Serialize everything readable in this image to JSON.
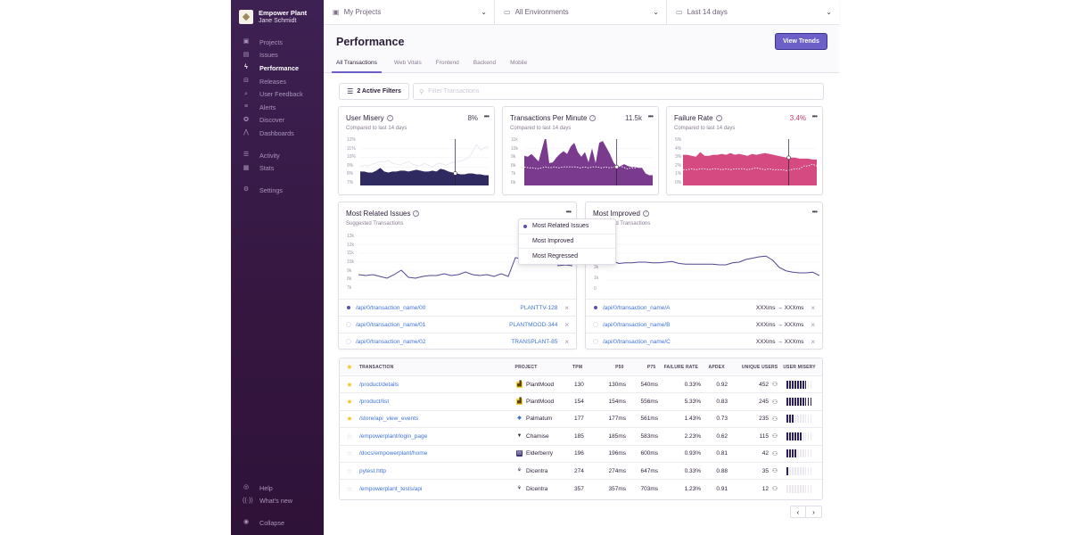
{
  "sidebar": {
    "org_name": "Empower Plant",
    "user_name": "Jane Schmidt",
    "items": [
      {
        "label": "Projects",
        "icon": "projects-icon",
        "glyph": "▣"
      },
      {
        "label": "Issues",
        "icon": "issues-icon",
        "glyph": "▤"
      },
      {
        "label": "Performance",
        "icon": "performance-icon",
        "glyph": "ϟ",
        "active": true
      },
      {
        "label": "Releases",
        "icon": "releases-icon",
        "glyph": "⊟"
      },
      {
        "label": "User Feedback",
        "icon": "user-feedback-icon",
        "glyph": "⌕"
      },
      {
        "label": "Alerts",
        "icon": "alerts-icon",
        "glyph": "≡"
      },
      {
        "label": "Discover",
        "icon": "discover-icon",
        "glyph": "✪"
      },
      {
        "label": "Dashboards",
        "icon": "dashboards-icon",
        "glyph": "⋀"
      }
    ],
    "items2": [
      {
        "label": "Activity",
        "icon": "activity-icon",
        "glyph": "☰"
      },
      {
        "label": "Stats",
        "icon": "stats-icon",
        "glyph": "▦"
      }
    ],
    "items3": [
      {
        "label": "Settings",
        "icon": "settings-icon",
        "glyph": "⚙"
      }
    ],
    "bottom": [
      {
        "label": "Help",
        "icon": "help-icon",
        "glyph": "◎"
      },
      {
        "label": "What's new",
        "icon": "broadcast-icon",
        "glyph": "((·))"
      },
      {
        "label": "Collapse",
        "icon": "collapse-icon",
        "glyph": "◉"
      }
    ]
  },
  "topbar": {
    "projects": "My Projects",
    "environments": "All Environments",
    "date_range": "Last 14 days"
  },
  "header": {
    "title": "Performance",
    "view_trends": "View Trends",
    "tabs": [
      "All Transactions",
      "Web Vitals",
      "Frontend",
      "Backend",
      "Mobile"
    ],
    "active_tab": "All Transactions"
  },
  "filters": {
    "active_filters_label": "2 Active Filters",
    "search_placeholder": "Filter Transactions"
  },
  "cards": {
    "user_misery": {
      "title": "User Misery",
      "value": "8%",
      "subtitle": "Compared to last 14 days",
      "y_ticks": [
        "12%",
        "11%",
        "10%",
        "9%",
        "8%",
        "7%"
      ],
      "color": "#2f2a5f"
    },
    "tpm": {
      "title": "Transactions Per Minute",
      "value": "11.5k",
      "subtitle": "Compared to last 14 days",
      "y_ticks": [
        "11k",
        "10k",
        "9k",
        "8k",
        "7k",
        "6k"
      ],
      "color": "#7a3b8e"
    },
    "failure_rate": {
      "title": "Failure Rate",
      "value": "3.4%",
      "subtitle": "Compared to last 14 days",
      "y_ticks": [
        "5%",
        "4%",
        "3%",
        "2%",
        "1%",
        "0%"
      ],
      "color": "#d64a82"
    }
  },
  "chart_data": [
    {
      "type": "area",
      "title": "User Misery",
      "ylim": [
        7,
        12
      ],
      "series": [
        {
          "name": "current",
          "values": [
            8.5,
            8.5,
            8.4,
            8.4,
            8.6,
            8.9,
            8.5,
            8.4,
            8.5,
            8.5,
            8.6,
            8.6,
            8.5,
            8.6,
            8.7,
            8.6,
            8.5,
            8.5,
            8.6,
            8.5,
            8.8,
            8.7,
            8.5,
            8.4,
            8.3,
            8.2,
            8.2,
            8.3,
            8.3,
            8.2,
            8.2,
            8.1,
            8.1
          ]
        },
        {
          "name": "previous",
          "values": [
            9.0,
            9.2,
            9.1,
            9.3,
            9.4,
            9.6,
            9.5,
            9.7,
            9.4,
            9.3,
            9.2,
            9.4,
            9.6,
            9.3,
            9.2,
            9.1,
            9.4,
            9.2,
            9.0,
            9.3,
            9.4,
            9.2,
            9.3,
            9.5,
            9.6,
            9.6,
            9.8,
            10.0,
            10.6,
            11.4,
            10.8,
            11.1,
            11.2
          ]
        }
      ]
    },
    {
      "type": "area",
      "title": "Transactions Per Minute",
      "ylim": [
        6,
        11
      ],
      "series": [
        {
          "name": "current",
          "values": [
            9.2,
            9.1,
            9.4,
            9.0,
            8.6,
            10.0,
            11.4,
            8.4,
            8.5,
            9.0,
            9.4,
            9.7,
            9.4,
            10.2,
            10.6,
            9.6,
            9.1,
            9.6,
            8.5,
            10.0,
            8.4,
            10.6,
            10.8,
            10.1,
            9.4,
            8.5,
            8.0,
            8.1,
            8.3,
            8.1,
            8.0,
            8.0,
            7.9,
            7.9,
            7.3,
            7.1,
            7.1
          ]
        },
        {
          "name": "previous",
          "values": [
            8.0,
            7.9,
            7.9,
            7.8,
            7.9,
            8.0,
            7.9,
            8.0,
            7.9,
            8.0,
            8.0,
            8.0,
            8.0,
            7.9,
            8.0,
            7.9,
            8.0,
            8.0,
            7.9,
            8.0,
            7.9,
            8.0,
            8.1,
            8.0,
            7.8,
            7.9,
            7.9,
            8.2,
            8.0,
            7.9,
            7.9
          ]
        }
      ]
    },
    {
      "type": "area",
      "title": "Failure Rate",
      "ylim": [
        0,
        5
      ],
      "series": [
        {
          "name": "current",
          "values": [
            3.3,
            3.3,
            3.2,
            3.1,
            3.6,
            3.2,
            3.2,
            3.3,
            3.3,
            3.4,
            3.3,
            3.5,
            3.3,
            3.4,
            3.3,
            3.2,
            3.4,
            3.3,
            3.4,
            3.5,
            3.4,
            3.3,
            3.2,
            3.1,
            3.0,
            3.0,
            3.0,
            2.9,
            2.9,
            2.9,
            2.8,
            2.8
          ]
        },
        {
          "name": "previous",
          "values": [
            1.7,
            1.7,
            1.8,
            1.7,
            1.8,
            1.8,
            1.7,
            1.8,
            1.8,
            1.7,
            1.8,
            1.7,
            1.8,
            1.8,
            1.8,
            1.7,
            1.8,
            1.9,
            1.8,
            1.7,
            1.8,
            1.7,
            1.7,
            1.7,
            1.6,
            1.7,
            1.8,
            1.8,
            2.1,
            2.1,
            2.3,
            2.1
          ]
        }
      ]
    },
    {
      "type": "line",
      "title": "Most Related Issues",
      "ylim": [
        7,
        13
      ],
      "y_ticks": [
        "13k",
        "12k",
        "11k",
        "10k",
        "9k",
        "8k",
        "7k"
      ],
      "series": [
        {
          "name": "/api/0/transaction_name/00",
          "values": [
            8.6,
            8.5,
            8.6,
            8.4,
            8.2,
            8.6,
            9.1,
            8.3,
            8.2,
            8.4,
            8.5,
            8.5,
            8.7,
            8.5,
            8.6,
            8.9,
            8.6,
            8.5,
            8.6,
            8.4,
            8.7,
            8.4,
            10.5,
            10.4,
            10.2,
            10.0,
            9.8,
            11.0,
            9.6,
            9.7,
            9.6
          ]
        }
      ]
    },
    {
      "type": "line",
      "title": "Most Improved",
      "y_ticks": [
        "3k",
        "1k",
        "0"
      ],
      "series": [
        {
          "name": "/api/0/transaction_name/A",
          "values": [
            6.8,
            7.2,
            6.8,
            6.9,
            6.9,
            7.0,
            7.0,
            6.9,
            6.9,
            7.0,
            7.1,
            6.8,
            6.7,
            6.7,
            6.7,
            6.7,
            6.7,
            6.6,
            6.6,
            6.9,
            7.0,
            7.4,
            7.6,
            7.8,
            7.9,
            7.3,
            6.2,
            5.7,
            5.5,
            5.4,
            5.4,
            5.5,
            5.0
          ]
        }
      ]
    }
  ],
  "most_related": {
    "title": "Most Related Issues",
    "subtitle": "Suggested Transactions",
    "rows": [
      {
        "name": "/api/0/transaction_name/00",
        "issue": "PLANTTV-128",
        "selected": true
      },
      {
        "name": "/api/0/transaction_name/01",
        "issue": "PLANTMOOD-344",
        "selected": false
      },
      {
        "name": "/api/0/transaction_name/02",
        "issue": "TRANSPLANT-85",
        "selected": false
      }
    ]
  },
  "most_improved": {
    "title": "Most Improved",
    "subtitle": "Suggested Transactions",
    "rows": [
      {
        "name": "/api/0/transaction_name/A",
        "before": "XXXms",
        "after": "XXXms",
        "selected": true
      },
      {
        "name": "/api/0/transaction_name/B",
        "before": "XXXms",
        "after": "XXXms",
        "selected": false
      },
      {
        "name": "/api/0/transaction_name/C",
        "before": "XXXms",
        "after": "XXXms",
        "selected": false
      }
    ]
  },
  "dropdown": {
    "options": [
      "Most Related Issues",
      "Most Improved",
      "Most Regressed"
    ],
    "selected": "Most Related Issues"
  },
  "table": {
    "columns": [
      "TRANSACTION",
      "PROJECT",
      "TPM",
      "P50",
      "P75",
      "FAILURE RATE",
      "APDEX",
      "UNIQUE USERS",
      "USER MISERY"
    ],
    "rows": [
      {
        "starred": true,
        "transaction": "/product/details",
        "project": "PlantMood",
        "tpm": "130",
        "p50": "130ms",
        "p75": "540ms",
        "failure_rate": "0.33%",
        "apdex": "0.92",
        "users": "452",
        "misery": 8
      },
      {
        "starred": true,
        "transaction": "/product/list",
        "project": "PlantMood",
        "tpm": "154",
        "p50": "154ms",
        "p75": "556ms",
        "failure_rate": "5.33%",
        "apdex": "0.83",
        "users": "245",
        "misery": 10
      },
      {
        "starred": true,
        "transaction": "/store/api_view_events",
        "project": "Palmatum",
        "tpm": "177",
        "p50": "177ms",
        "p75": "561ms",
        "failure_rate": "1.43%",
        "apdex": "0.73",
        "users": "235",
        "misery": 3
      },
      {
        "starred": false,
        "transaction": "/empowerplant/login_page",
        "project": "Chamise",
        "tpm": "185",
        "p50": "185ms",
        "p75": "583ms",
        "failure_rate": "2.23%",
        "apdex": "0.62",
        "users": "115",
        "misery": 6
      },
      {
        "starred": false,
        "transaction": "/docs/empowerplant/home",
        "project": "Elderberry",
        "tpm": "196",
        "p50": "196ms",
        "p75": "600ms",
        "failure_rate": "0.93%",
        "apdex": "0.81",
        "users": "42",
        "misery": 4
      },
      {
        "starred": false,
        "transaction": "pytest.http",
        "project": "Dicentra",
        "tpm": "274",
        "p50": "274ms",
        "p75": "647ms",
        "failure_rate": "0.33%",
        "apdex": "0.88",
        "users": "35",
        "misery": 1
      },
      {
        "starred": false,
        "transaction": "/empowerplant_tests/api",
        "project": "Dicentra",
        "tpm": "357",
        "p50": "357ms",
        "p75": "703ms",
        "failure_rate": "1.23%",
        "apdex": "0.91",
        "users": "12",
        "misery": 0
      }
    ],
    "misery_max": 10,
    "project_icons": {
      "PlantMood": {
        "glyph": "▟",
        "bg": "#f4cf3a",
        "fg": "#5a4200"
      },
      "Palmatum": {
        "glyph": "◆",
        "bg": "#ffffff",
        "fg": "#3a72c4"
      },
      "Chamise": {
        "glyph": "▼",
        "bg": "#ffffff",
        "fg": "#3e3446"
      },
      "Elderberry": {
        "glyph": "▤",
        "bg": "#3c3570",
        "fg": "#c8c2ee"
      },
      "Dicentra": {
        "glyph": "⚘",
        "bg": "#ffffff",
        "fg": "#2b1d38"
      }
    }
  },
  "pagination": {
    "prev": "‹",
    "next": "›"
  }
}
